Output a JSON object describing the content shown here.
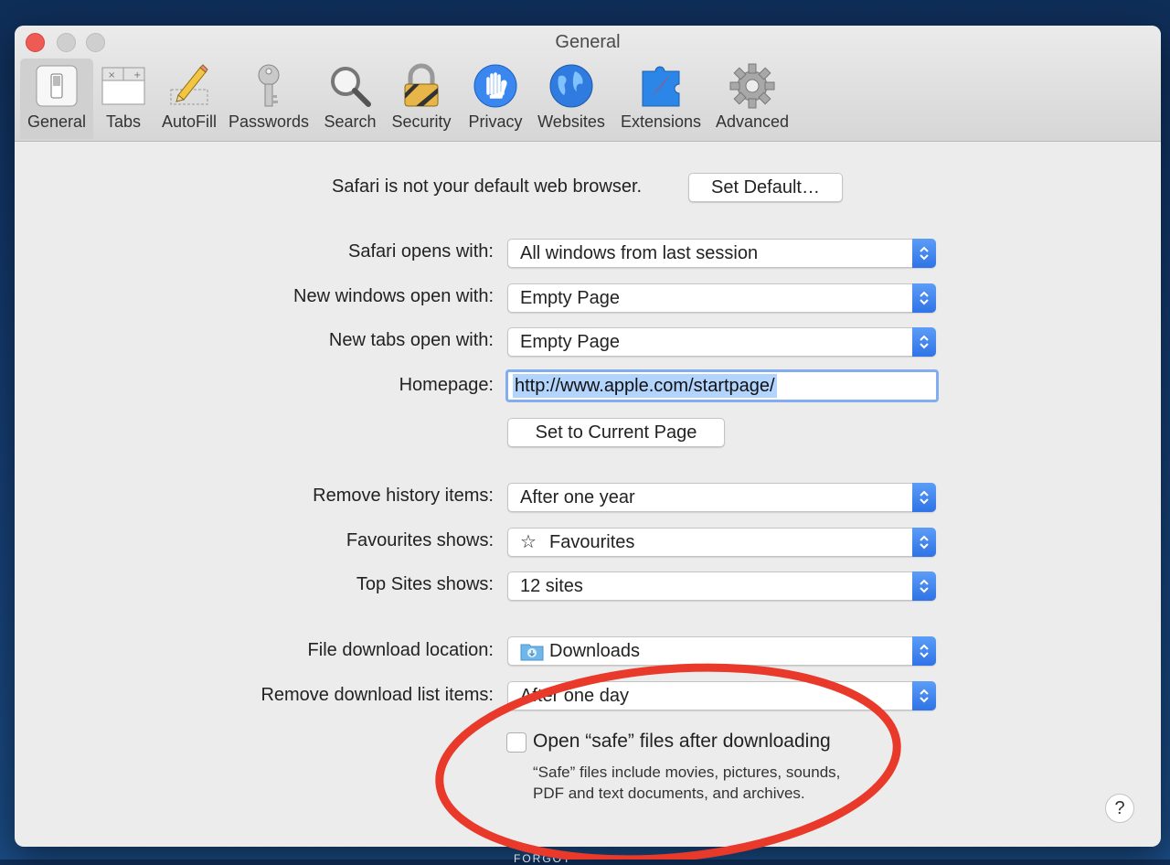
{
  "window": {
    "title": "General"
  },
  "toolbar": {
    "items": [
      {
        "label": "General",
        "icon": "general-switch-icon"
      },
      {
        "label": "Tabs",
        "icon": "tabs-icon"
      },
      {
        "label": "AutoFill",
        "icon": "pencil-icon"
      },
      {
        "label": "Passwords",
        "icon": "key-icon"
      },
      {
        "label": "Search",
        "icon": "magnifier-icon"
      },
      {
        "label": "Security",
        "icon": "padlock-icon"
      },
      {
        "label": "Privacy",
        "icon": "hand-icon"
      },
      {
        "label": "Websites",
        "icon": "globe-icon"
      },
      {
        "label": "Extensions",
        "icon": "puzzle-compass-icon"
      },
      {
        "label": "Advanced",
        "icon": "gear-icon"
      }
    ],
    "active": "General"
  },
  "default_browser": {
    "message": "Safari is not your default web browser.",
    "button": "Set Default…"
  },
  "settings": {
    "safari_opens_with": {
      "label": "Safari opens with:",
      "value": "All windows from last session"
    },
    "new_windows_open_with": {
      "label": "New windows open with:",
      "value": "Empty Page"
    },
    "new_tabs_open_with": {
      "label": "New tabs open with:",
      "value": "Empty Page"
    },
    "homepage": {
      "label": "Homepage:",
      "value": "http://www.apple.com/startpage/"
    },
    "set_current_page_button": "Set to Current Page",
    "remove_history_items": {
      "label": "Remove history items:",
      "value": "After one year"
    },
    "favourites_shows": {
      "label": "Favourites shows:",
      "value": "Favourites"
    },
    "top_sites_shows": {
      "label": "Top Sites shows:",
      "value": "12 sites"
    },
    "file_download_location": {
      "label": "File download location:",
      "value": "Downloads"
    },
    "remove_download_list_items": {
      "label": "Remove download list items:",
      "value": "After one day"
    },
    "open_safe_files": {
      "label": "Open “safe” files after downloading",
      "checked": false,
      "description": "“Safe” files include movies, pictures, sounds, PDF and text documents, and archives."
    }
  },
  "help_button": "?",
  "footer_text": "FORGOT",
  "colors": {
    "accent": "#2f73e6",
    "annotation": "#e8392a",
    "selection": "#b3d4fd",
    "close": "#ee5b55"
  }
}
